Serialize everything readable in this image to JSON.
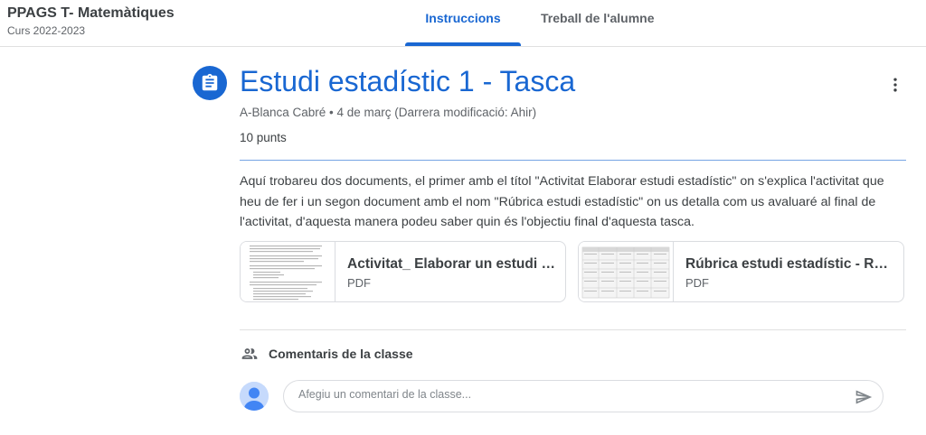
{
  "header": {
    "course_name": "PPAGS T- Matemàtiques",
    "course_term": "Curs 2022-2023",
    "tabs": [
      {
        "label": "Instruccions",
        "active": true
      },
      {
        "label": "Treball de l'alumne",
        "active": false
      }
    ]
  },
  "assignment": {
    "title": "Estudi estadístic 1 - Tasca",
    "meta": "A-Blanca Cabré • 4 de març (Darrera modificació: Ahir)",
    "points": "10 punts",
    "description": "Aquí trobareu dos documents, el primer amb el títol \"Activitat Elaborar estudi estadístic\" on s'explica l'activitat que heu de fer i un segon document amb el nom \"Rúbrica estudi estadístic\" on us detalla com us avaluaré al final de l'activitat, d'aquesta manera podeu saber quin és l'objectiu final d'aquesta tasca."
  },
  "attachments": [
    {
      "name": "Activitat_ Elaborar un estudi estadístic",
      "type": "PDF"
    },
    {
      "name": "Rúbrica estudi estadístic - Rúbrica",
      "type": "PDF"
    }
  ],
  "comments": {
    "label": "Comentaris de la classe",
    "placeholder": "Afegiu un comentari de la classe..."
  },
  "colors": {
    "accent": "#1967d2",
    "text": "#3c4043",
    "muted": "#5f6368",
    "border": "#dadce0"
  },
  "icons": {
    "assignment": "assignment-icon",
    "more": "more-vert-icon",
    "comments": "people-icon",
    "send": "send-icon",
    "avatar": "avatar-icon"
  }
}
